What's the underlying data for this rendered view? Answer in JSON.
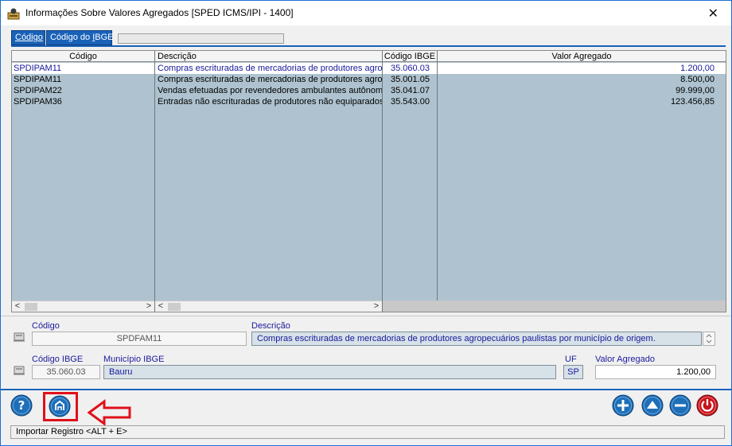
{
  "window": {
    "title": "Informações Sobre Valores Agregados  [SPED ICMS/IPI - 1400]",
    "close_glyph": "✕"
  },
  "tabs": [
    {
      "label": "Código"
    },
    {
      "label_pre": "Código do ",
      "label_u": "I",
      "label_post": "BGE"
    }
  ],
  "grid": {
    "columns": [
      "Código",
      "Descrição",
      "Código IBGE",
      "Valor Agregado"
    ],
    "rows": [
      {
        "codigo": "SPDIPAM11",
        "descricao": "Compras escrituradas de mercadorias de produtores agro",
        "ibge": "35.060.03",
        "valor": "1.200,00",
        "selected": true
      },
      {
        "codigo": "SPDIPAM11",
        "descricao": "Compras escrituradas de mercadorias de produtores agro",
        "ibge": "35.001.05",
        "valor": "8.500,00",
        "selected": false
      },
      {
        "codigo": "SPDIPAM22",
        "descricao": "Vendas efetuadas por revendedores ambulantes autônom",
        "ibge": "35.041.07",
        "valor": "99.999,00",
        "selected": false
      },
      {
        "codigo": "SPDIPAM36",
        "descricao": "Entradas não escrituradas de produtores não equiparados",
        "ibge": "35.543.00",
        "valor": "123.456,85",
        "selected": false
      }
    ],
    "scroll_left": "<",
    "scroll_right": ">"
  },
  "form": {
    "codigo_label": "Código",
    "codigo_value": "SPDFAM11",
    "descricao_label": "Descrição",
    "descricao_value": "Compras escrituradas de mercadorias de produtores agropecuários paulistas por município de origem.",
    "codigo_ibge_label": "Código IBGE",
    "codigo_ibge_value": "35.060.03",
    "municipio_label": "Município IBGE",
    "municipio_value": "Bauru",
    "uf_label": "UF",
    "uf_value": "SP",
    "valor_label": "Valor Agregado",
    "valor_value": "1.200,00"
  },
  "status_bar": {
    "text": "Importar Registro  <ALT + E>"
  },
  "colors": {
    "accent": "#1a62b8",
    "grid_bg": "#aec3cf",
    "highlight_red": "#e0101a"
  },
  "icons": [
    "help-icon",
    "import-icon",
    "add-icon",
    "up-icon",
    "remove-icon",
    "power-icon",
    "arrow-left-icon"
  ]
}
